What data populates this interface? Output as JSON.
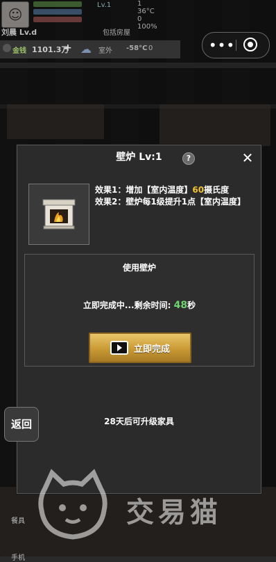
{
  "hud": {
    "player_name": "刘晨 Lv.d",
    "level": "Lv.1",
    "stats_right": [
      "1",
      "36°C",
      "0",
      "100%"
    ],
    "backpack_label": "包括房屋",
    "money_label": "金钱",
    "money_value": "1101.3万",
    "plus": "+",
    "outdoor_label": "室外",
    "outdoor_temp": "-58°C",
    "outdoor_zero": "0"
  },
  "capsule": {
    "more": "•••"
  },
  "dialog": {
    "title": "壁炉 Lv:1",
    "help": "?",
    "close": "✕",
    "effect1_prefix": "效果1：增加【室内温度】",
    "effect1_value": "60",
    "effect1_suffix": "摄氏度",
    "effect2": "效果2：壁炉每1级提升1点【室内温度】",
    "use_title": "使用壁炉",
    "remain_prefix": "立即完成中...剩余时间: ",
    "remain_value": "48",
    "remain_suffix": "秒",
    "complete_label": "立即完成",
    "upgrade_note": "28天后可升级家具"
  },
  "back_button": "返回",
  "watermark": {
    "text": "交易猫"
  },
  "bottom": {
    "label1": "餐具",
    "label2": "手机"
  },
  "colors": {
    "highlight_yellow": "#f2c230",
    "highlight_green": "#6fd36f",
    "button_gold": "#c99a34"
  }
}
